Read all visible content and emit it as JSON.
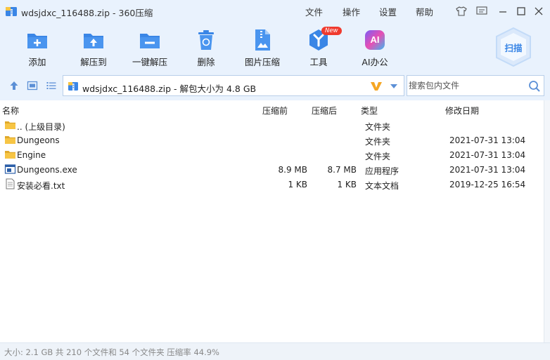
{
  "window": {
    "title": "wdsjdxc_116488.zip - 360压缩",
    "menu": [
      "文件",
      "操作",
      "设置",
      "帮助"
    ]
  },
  "toolbar": {
    "items": [
      {
        "label": "添加",
        "icon": "add-icon"
      },
      {
        "label": "解压到",
        "icon": "extract-to-icon"
      },
      {
        "label": "一键解压",
        "icon": "one-click-extract-icon"
      },
      {
        "label": "删除",
        "icon": "delete-icon"
      },
      {
        "label": "图片压缩",
        "icon": "image-compress-icon"
      },
      {
        "label": "工具",
        "icon": "tools-icon",
        "badge": "New"
      },
      {
        "label": "AI办公",
        "icon": "ai-office-icon"
      }
    ],
    "scan_label": "扫描",
    "ai_icon_text": "AI"
  },
  "address": {
    "path": "wdsjdxc_116488.zip - 解包大小为 4.8 GB",
    "search_placeholder": "搜索包内文件"
  },
  "columns": [
    "名称",
    "压缩前",
    "压缩后",
    "类型",
    "修改日期"
  ],
  "files": [
    {
      "name": ".. (上级目录)",
      "before": "",
      "after": "",
      "type": "文件夹",
      "date": "",
      "icon": "folder-icon"
    },
    {
      "name": "Dungeons",
      "before": "",
      "after": "",
      "type": "文件夹",
      "date": "2021-07-31 13:04",
      "icon": "folder-icon"
    },
    {
      "name": "Engine",
      "before": "",
      "after": "",
      "type": "文件夹",
      "date": "2021-07-31 13:04",
      "icon": "folder-icon"
    },
    {
      "name": "Dungeons.exe",
      "before": "8.9 MB",
      "after": "8.7 MB",
      "type": "应用程序",
      "date": "2021-07-31 13:04",
      "icon": "exe-icon"
    },
    {
      "name": "安装必看.txt",
      "before": "1 KB",
      "after": "1 KB",
      "type": "文本文档",
      "date": "2019-12-25 16:54",
      "icon": "text-file-icon"
    }
  ],
  "status": "大小: 2.1 GB 共 210 个文件和 54 个文件夹 压缩率 44.9%",
  "colors": {
    "chrome_bg": "#e9f2fd",
    "accent_blue": "#3a86e6",
    "folder_yellow": "#f7c544",
    "badge_red": "#f03a2e"
  }
}
